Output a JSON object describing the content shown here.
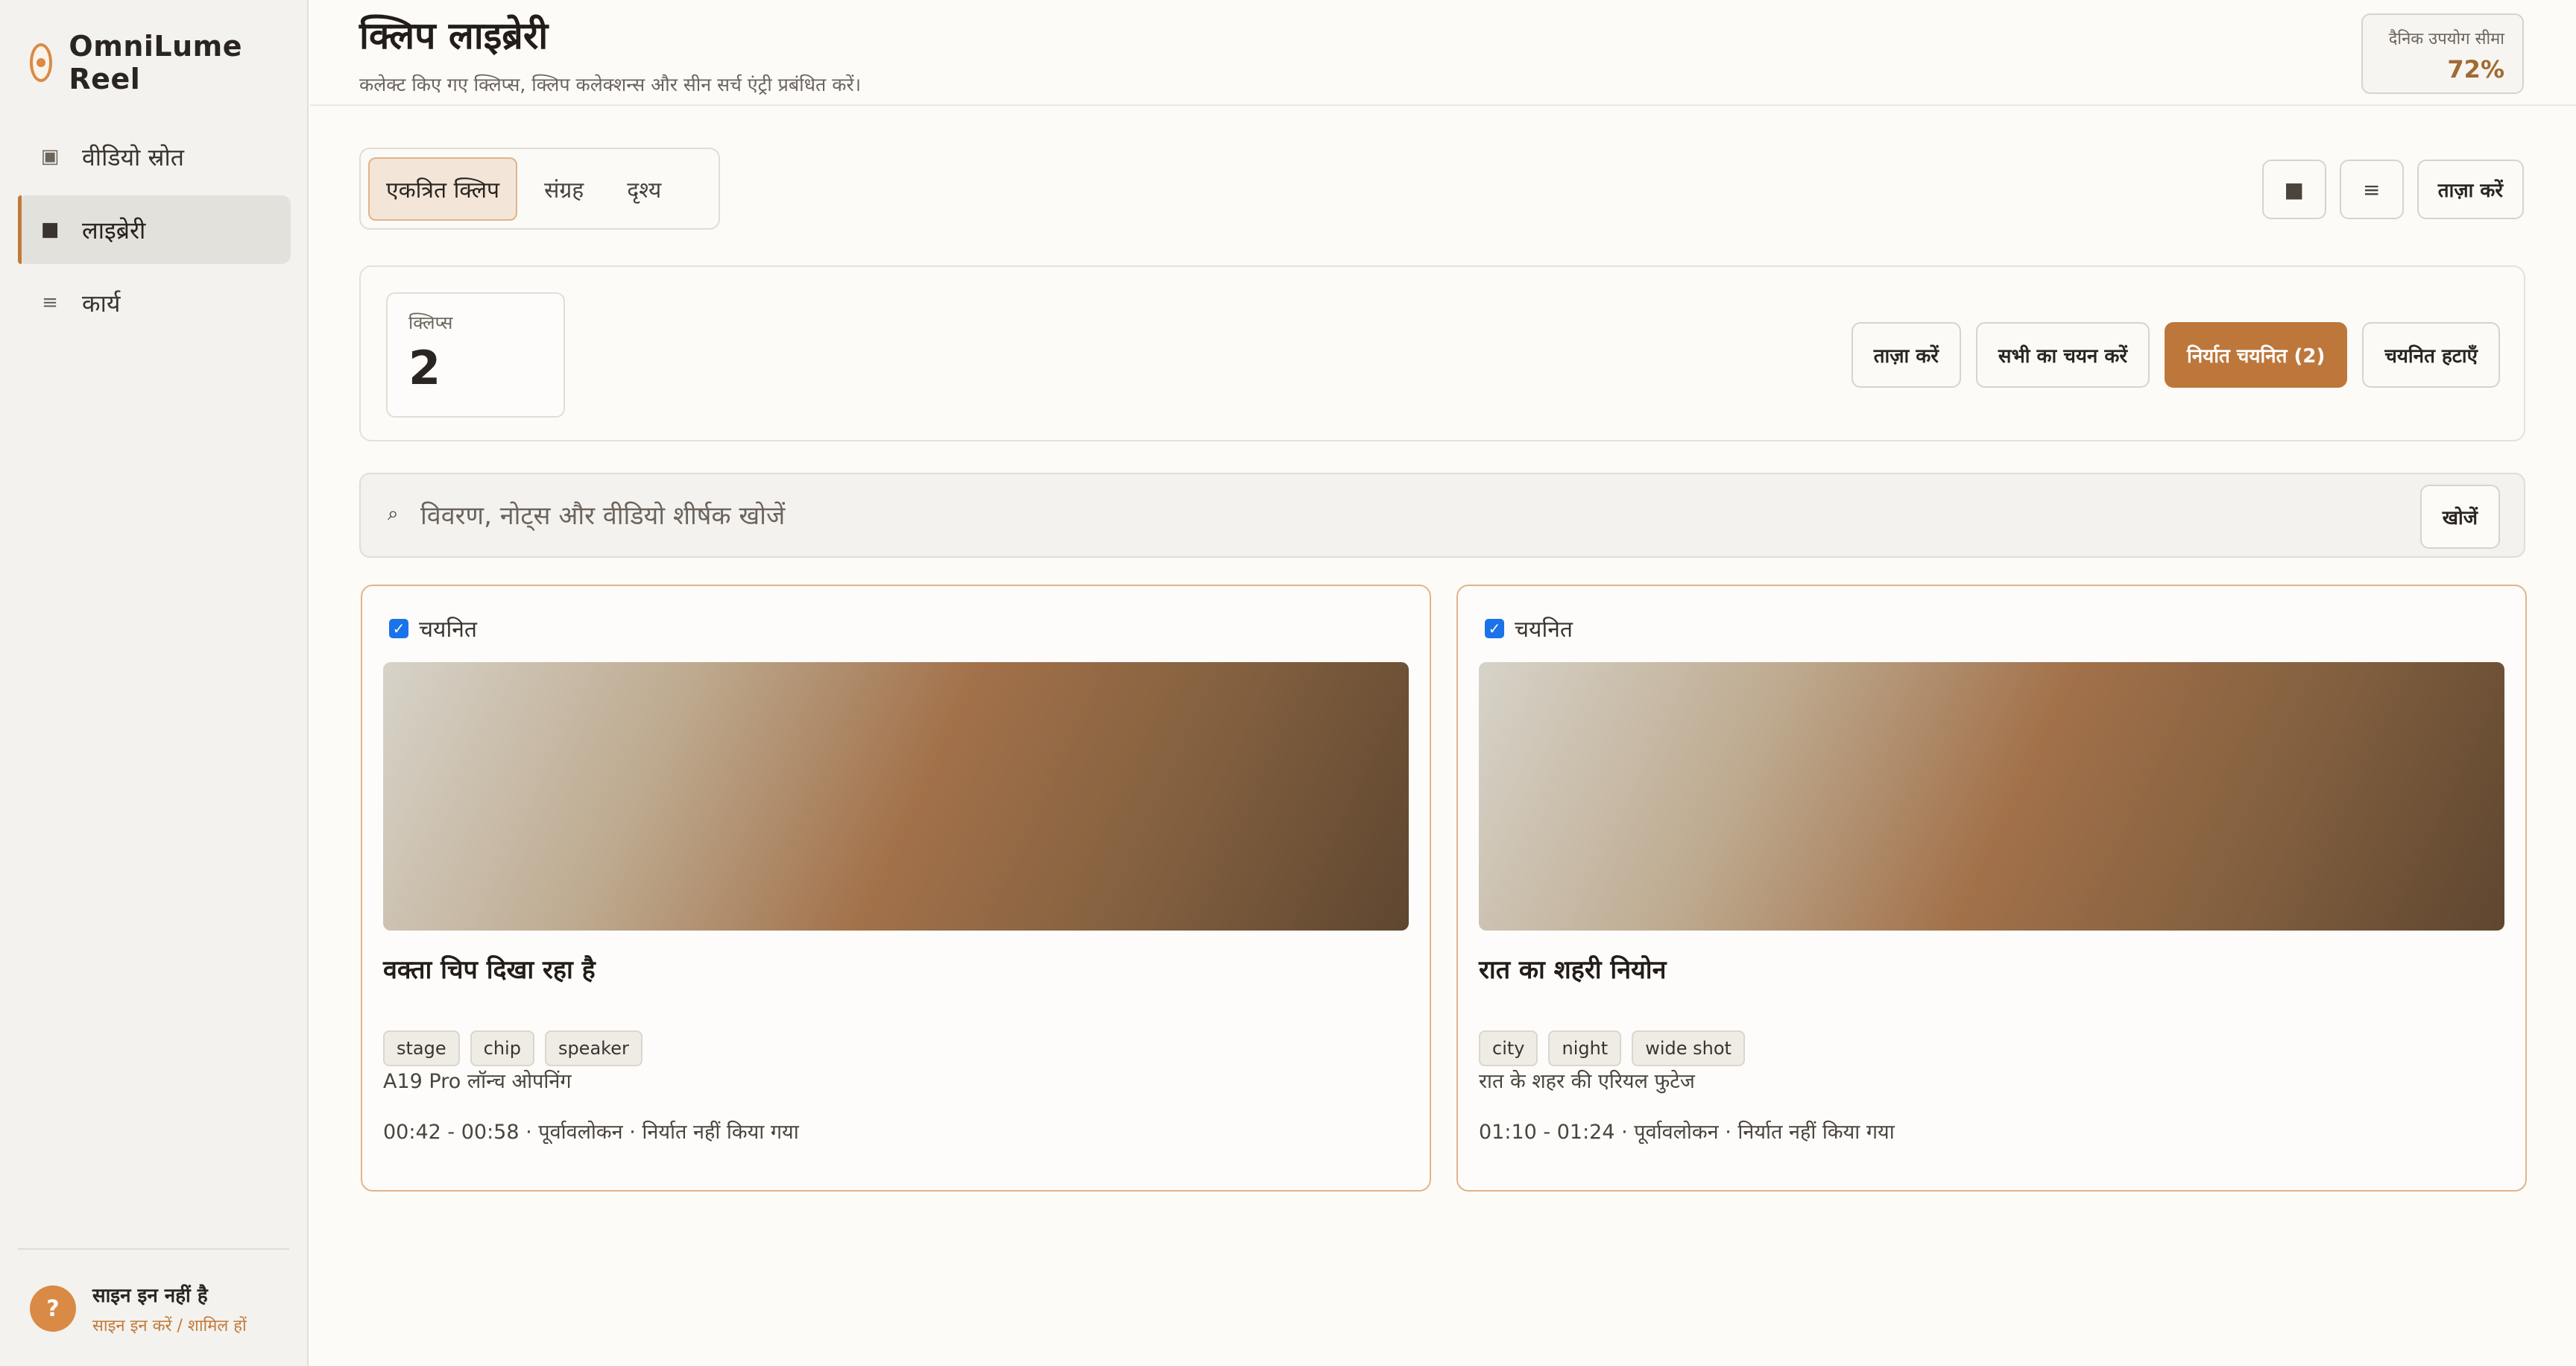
{
  "app": {
    "name": "OmniLume Reel"
  },
  "sidebar": {
    "items": [
      {
        "icon": "▣",
        "label": "वीडियो स्रोत"
      },
      {
        "icon": "■",
        "label": "लाइब्रेरी"
      },
      {
        "icon": "≡",
        "label": "कार्य"
      }
    ],
    "user": {
      "avatar": "?",
      "status": "साइन इन नहीं है",
      "link": "साइन इन करें / शामिल हों"
    }
  },
  "header": {
    "title": "क्लिप लाइब्रेरी",
    "subtitle": "कलेक्ट किए गए क्लिप्स, क्लिप कलेक्शन्स और सीन सर्च एंट्री प्रबंधित करें।",
    "usage": {
      "label": "दैनिक उपयोग सीमा",
      "value": "72%"
    }
  },
  "tabs": [
    {
      "label": "एकत्रित क्लिप"
    },
    {
      "label": "संग्रह"
    },
    {
      "label": "दृश्य"
    }
  ],
  "toolbar": {
    "grid_icon": "■",
    "list_icon": "≡",
    "refresh_label": "ताज़ा करें"
  },
  "stats": {
    "clips_label": "क्लिप्स",
    "clips_value": "2"
  },
  "actions": {
    "refresh": "ताज़ा करें",
    "select_all": "सभी का चयन करें",
    "export_selected": "निर्यात चयनित (2)",
    "remove_selected": "चयनित हटाएँ"
  },
  "search": {
    "icon": "⌕",
    "placeholder": "विवरण, नोट्स और वीडियो शीर्षक खोजें",
    "value": "",
    "button": "खोजें"
  },
  "cards": [
    {
      "selected_label": "चयनित",
      "title": "वक्ता चिप दिखा रहा है",
      "tags": [
        "stage",
        "chip",
        "speaker"
      ],
      "description": "A19 Pro लॉन्च ओपनिंग",
      "meta": "00:42 - 00:58 · पूर्वावलोकन · निर्यात नहीं किया गया"
    },
    {
      "selected_label": "चयनित",
      "title": "रात का शहरी नियोन",
      "tags": [
        "city",
        "night",
        "wide shot"
      ],
      "description": "रात के शहर की एरियल फुटेज",
      "meta": "01:10 - 01:24 · पूर्वावलोकन · निर्यात नहीं किया गया"
    }
  ],
  "colors": {
    "accent": "#bd773b",
    "card_border": "#e3b48c",
    "checkbox": "#1a73e8"
  }
}
